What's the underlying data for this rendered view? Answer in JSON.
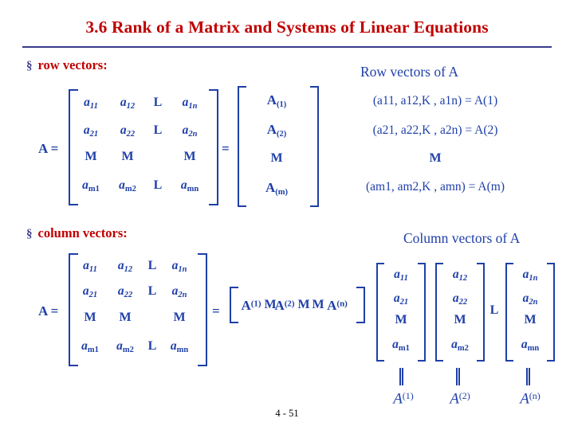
{
  "slide": {
    "title": "3.6 Rank of a Matrix and Systems of Linear Equations",
    "footer": "4 - 51",
    "colors": {
      "title": "#c00000",
      "bullet_text": "#c00000",
      "bullet_mark": "#3a3a8c",
      "math": "#1f3fa8",
      "rule": "#3a3a8c"
    }
  },
  "sections": {
    "row": {
      "bullet_mark": "§",
      "bullet_label": "row vectors:",
      "caption": "Row vectors of A",
      "A_label": "A",
      "equals": "=",
      "matrix": {
        "rows": [
          [
            "a",
            "a",
            "L",
            "a"
          ],
          [
            "a",
            "a",
            "L",
            "a"
          ],
          [
            "M",
            "M",
            "",
            "M"
          ],
          [
            "a",
            "a",
            "L",
            "a"
          ]
        ],
        "subs": [
          [
            "11",
            "12",
            "",
            "1n"
          ],
          [
            "21",
            "22",
            "",
            "2n"
          ],
          [
            "",
            "",
            "",
            ""
          ],
          [
            "m1",
            "m2",
            "",
            "mn"
          ]
        ]
      },
      "row_vector_column": [
        "A",
        "A",
        "M",
        "A"
      ],
      "row_vector_subs": [
        "(1)",
        "(2)",
        "",
        "(m)"
      ],
      "expansions": [
        "(a11, a12,K , a1n) = A(1)",
        "(a21, a22,K , a2n) = A(2)",
        "M",
        "(am1, am2,K , amn) = A(m)"
      ]
    },
    "column": {
      "bullet_mark": "§",
      "bullet_label": "column vectors:",
      "caption": "Column vectors of A",
      "A_label": "A",
      "equals": "=",
      "matrix": {
        "rows": [
          [
            "a",
            "a",
            "L",
            "a"
          ],
          [
            "a",
            "a",
            "L",
            "a"
          ],
          [
            "M",
            "M",
            "",
            "M"
          ],
          [
            "a",
            "a",
            "L",
            "a"
          ]
        ],
        "subs": [
          [
            "11",
            "12",
            "",
            "1n"
          ],
          [
            "21",
            "22",
            "",
            "2n"
          ],
          [
            "",
            "",
            "",
            ""
          ],
          [
            "m1",
            "m2",
            "",
            "mn"
          ]
        ]
      },
      "row_form": [
        "A",
        "(1)",
        "M",
        "A",
        "(2)",
        "M",
        "M",
        "A",
        "(n)"
      ],
      "col_blocks": [
        {
          "cells": [
            "a",
            "a",
            "M",
            "a"
          ],
          "subs": [
            "11",
            "21",
            "",
            "m1"
          ]
        },
        {
          "cells": [
            "a",
            "a",
            "M",
            "a"
          ],
          "subs": [
            "12",
            "22",
            "",
            "m2"
          ]
        },
        {
          "cells": [
            "a",
            "a",
            "M",
            "a"
          ],
          "subs": [
            "1n",
            "2n",
            "",
            "mn"
          ]
        }
      ],
      "separator": "L",
      "under_labels": [
        {
          "base": "A",
          "sup": "(1)"
        },
        {
          "base": "A",
          "sup": "(2)"
        },
        {
          "base": "A",
          "sup": "(n)"
        }
      ]
    }
  }
}
